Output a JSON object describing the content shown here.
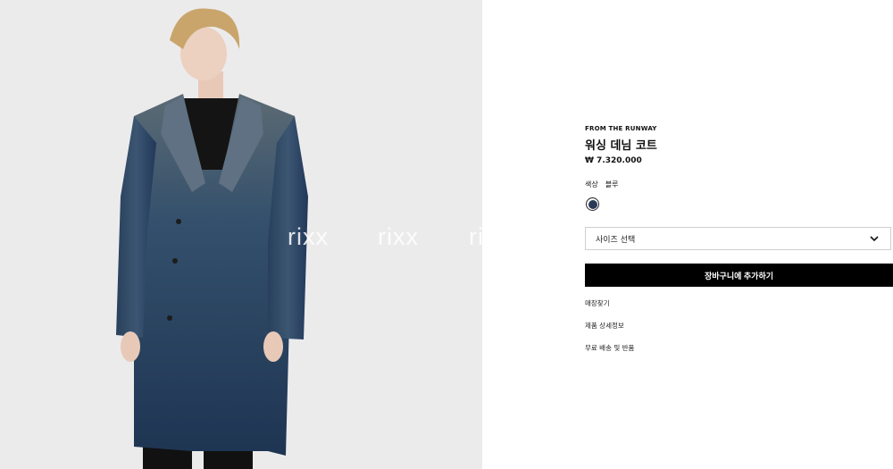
{
  "image": {
    "alt_icon": "product-photo",
    "background": "#ecebec",
    "watermark": [
      "rixx",
      "rixx",
      "rixx"
    ]
  },
  "product": {
    "kicker": "FROM THE RUNWAY",
    "title": "워싱 데님 코트",
    "price": "₩ 7.320.000"
  },
  "color": {
    "label": "색상",
    "value": "블루",
    "swatch_hex": "#2a3b57"
  },
  "size_select": {
    "value": "사이즈 선택",
    "icon": "chevron-down-icon"
  },
  "actions": {
    "add_to_cart": "장바구니에 추가하기"
  },
  "links": [
    "매장찾기",
    "제품 상세정보",
    "무료 배송 및 반품"
  ],
  "colors": {
    "button_bg": "#000000",
    "button_text": "#ffffff",
    "border": "#cfcfcf"
  }
}
